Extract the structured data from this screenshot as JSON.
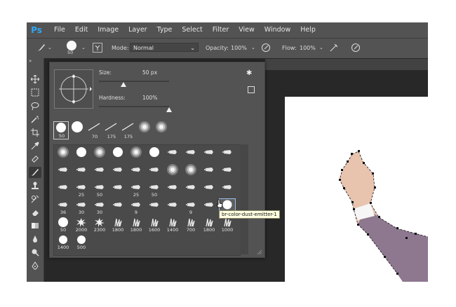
{
  "app": {
    "logo": "Ps"
  },
  "menu": [
    "File",
    "Edit",
    "Image",
    "Layer",
    "Type",
    "Select",
    "Filter",
    "View",
    "Window",
    "Help"
  ],
  "options": {
    "brush_size": "50",
    "mode_label": "Mode:",
    "mode_value": "Normal",
    "opacity_label": "Opacity:",
    "opacity_value": "100%",
    "flow_label": "Flow:",
    "flow_value": "100%"
  },
  "toolbar": {
    "collapse_label": "»"
  },
  "brush_panel": {
    "size_label": "Size:",
    "size_value": "50 px",
    "size_fraction": 0.35,
    "hardness_label": "Hardness:",
    "hardness_value": "100%",
    "hardness_fraction": 1.0,
    "recent": [
      {
        "label": "50",
        "kind": "hard"
      },
      {
        "label": "",
        "kind": "hard-big"
      },
      {
        "label": "70",
        "kind": "stroke"
      },
      {
        "label": "175",
        "kind": "stroke"
      },
      {
        "label": "175",
        "kind": "stroke"
      },
      {
        "label": "",
        "kind": "soft"
      },
      {
        "label": "",
        "kind": "soft"
      }
    ],
    "grid_rows": [
      [
        {
          "kind": "soft",
          "label": ""
        },
        {
          "kind": "hard",
          "label": ""
        },
        {
          "kind": "soft",
          "label": ""
        },
        {
          "kind": "hard",
          "label": ""
        },
        {
          "kind": "soft",
          "label": ""
        },
        {
          "kind": "hard",
          "label": ""
        },
        {
          "kind": "tip",
          "label": ""
        },
        {
          "kind": "tip",
          "label": ""
        },
        {
          "kind": "tip",
          "label": ""
        },
        {
          "kind": "tip",
          "label": ""
        }
      ],
      [
        {
          "kind": "tip",
          "label": ""
        },
        {
          "kind": "tip",
          "label": ""
        },
        {
          "kind": "tip",
          "label": ""
        },
        {
          "kind": "tip",
          "label": ""
        },
        {
          "kind": "tip",
          "label": ""
        },
        {
          "kind": "tip",
          "label": ""
        },
        {
          "kind": "soft",
          "label": ""
        },
        {
          "kind": "soft",
          "label": ""
        },
        {
          "kind": "tip",
          "label": ""
        },
        {
          "kind": "tip",
          "label": ""
        }
      ],
      [
        {
          "kind": "tip",
          "label": ""
        },
        {
          "kind": "tip",
          "label": "25"
        },
        {
          "kind": "tip",
          "label": "50"
        },
        {
          "kind": "tip",
          "label": ""
        },
        {
          "kind": "tip",
          "label": "25"
        },
        {
          "kind": "tip",
          "label": "50"
        },
        {
          "kind": "tip",
          "label": ""
        },
        {
          "kind": "tip",
          "label": ""
        },
        {
          "kind": "tip",
          "label": ""
        },
        {
          "kind": "tip",
          "label": ""
        }
      ],
      [
        {
          "kind": "tip",
          "label": "36"
        },
        {
          "kind": "tip",
          "label": "30"
        },
        {
          "kind": "tip",
          "label": "30"
        },
        {
          "kind": "tip",
          "label": ""
        },
        {
          "kind": "tip",
          "label": "9"
        },
        {
          "kind": "tip",
          "label": ""
        },
        {
          "kind": "tip",
          "label": ""
        },
        {
          "kind": "tip",
          "label": "9"
        },
        {
          "kind": "tip",
          "label": ""
        },
        {
          "kind": "hard-sel",
          "label": "9"
        }
      ],
      [
        {
          "kind": "hard",
          "label": "50"
        },
        {
          "kind": "splat",
          "label": "2000"
        },
        {
          "kind": "splat",
          "label": "2300"
        },
        {
          "kind": "grass",
          "label": "1800"
        },
        {
          "kind": "grass",
          "label": "1800"
        },
        {
          "kind": "grass",
          "label": "1600"
        },
        {
          "kind": "grass",
          "label": "1400"
        },
        {
          "kind": "grass",
          "label": "700"
        },
        {
          "kind": "grass",
          "label": "1800"
        },
        {
          "kind": "grass",
          "label": "1000"
        }
      ],
      [
        {
          "kind": "dot",
          "label": "1400"
        },
        {
          "kind": "dot",
          "label": "500"
        }
      ]
    ],
    "tooltip": "br-color-dust-emitter-1"
  }
}
